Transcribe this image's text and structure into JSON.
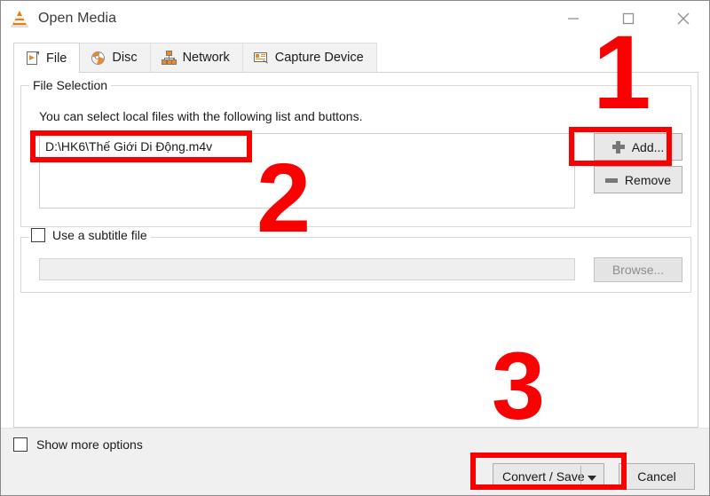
{
  "window": {
    "title": "Open Media",
    "app_icon": "vlc-cone-icon",
    "controls": {
      "minimize": "minimize-icon",
      "maximize": "maximize-icon",
      "close": "close-icon"
    }
  },
  "tabs": [
    {
      "label": "File",
      "icon": "file-icon",
      "active": true
    },
    {
      "label": "Disc",
      "icon": "disc-icon",
      "active": false
    },
    {
      "label": "Network",
      "icon": "network-icon",
      "active": false
    },
    {
      "label": "Capture Device",
      "icon": "capture-device-icon",
      "active": false
    }
  ],
  "file_selection": {
    "group_title": "File Selection",
    "hint": "You can select local files with the following list and buttons.",
    "files": [
      "D:\\HK6\\Thế Giới Di Động.m4v"
    ],
    "add_button": "Add...",
    "remove_button": "Remove"
  },
  "subtitle": {
    "checkbox_label": "Use a subtitle file",
    "checked": false,
    "path_value": "",
    "path_placeholder": "",
    "browse_button": "Browse..."
  },
  "footer": {
    "show_more_label": "Show more options",
    "show_more_checked": false,
    "convert_save_button": "Convert / Save",
    "convert_save_dropdown": "chevron-down-icon",
    "cancel_button": "Cancel"
  },
  "annotations": {
    "colors": {
      "highlight": "#fb0000"
    },
    "steps": [
      {
        "number": "1",
        "target": "add-button"
      },
      {
        "number": "2",
        "target": "file-list-item"
      },
      {
        "number": "3",
        "target": "convert-save-button"
      }
    ]
  }
}
